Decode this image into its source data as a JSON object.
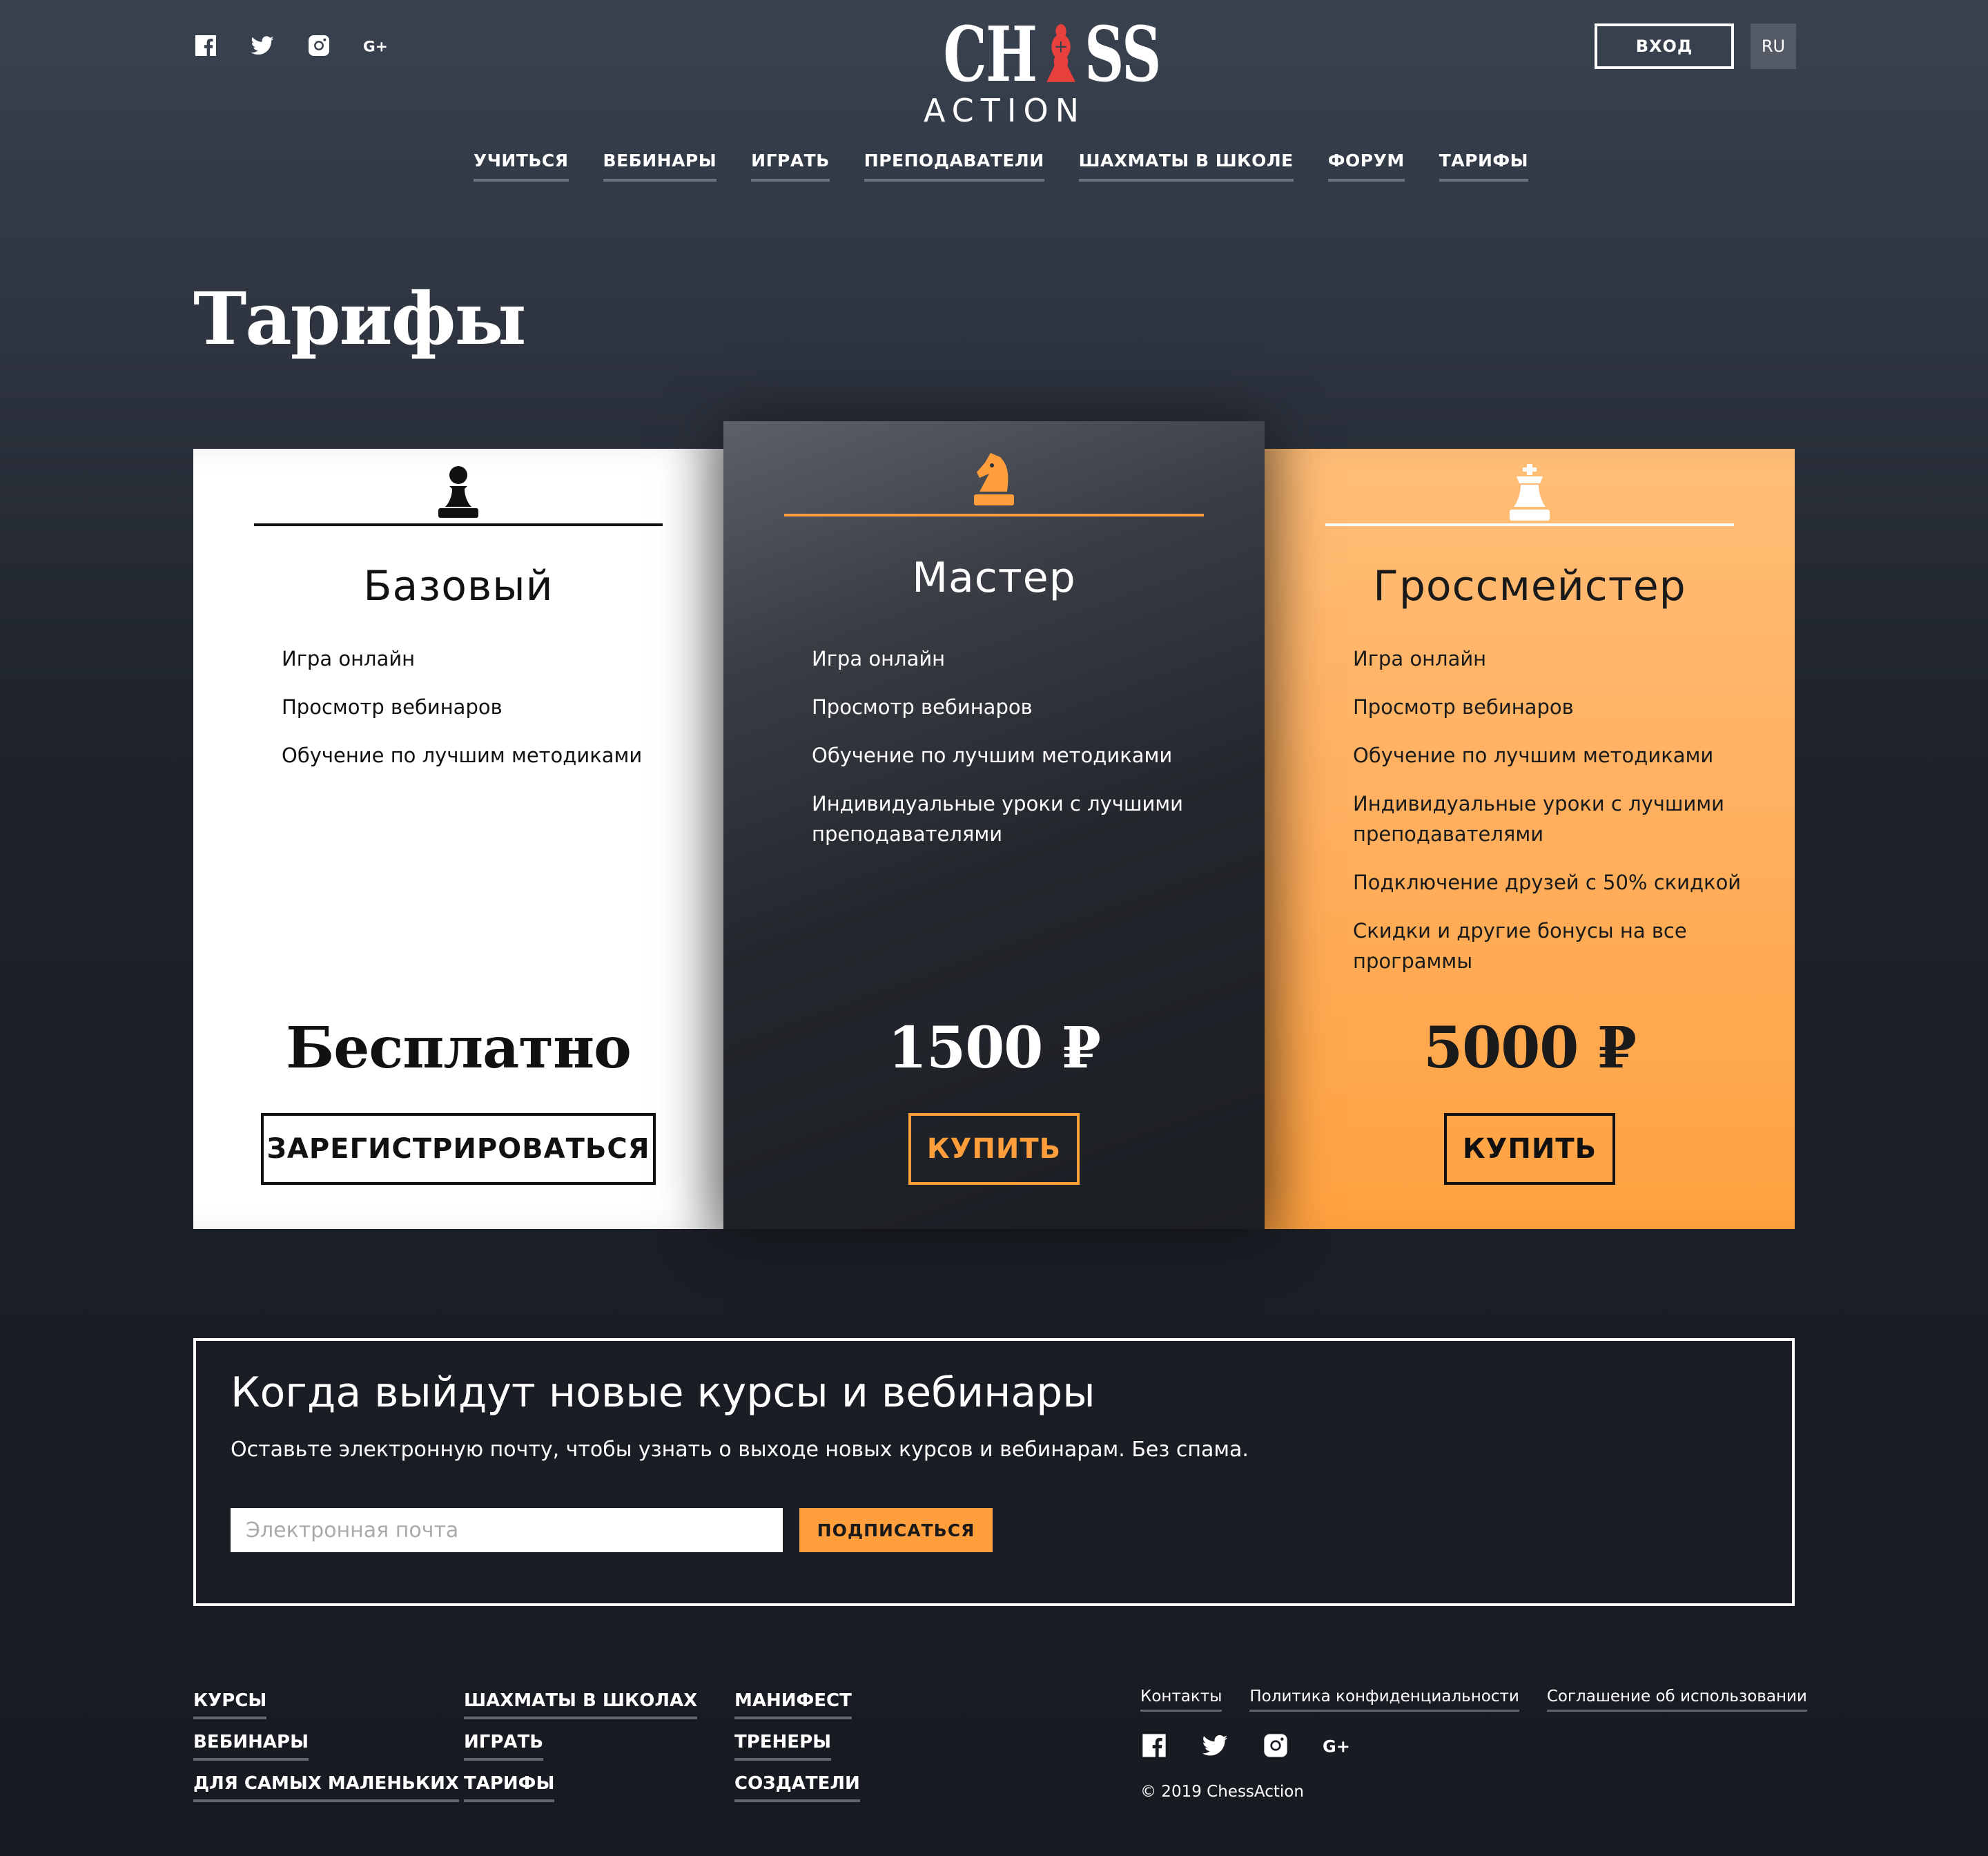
{
  "header": {
    "social_icons": [
      "facebook-icon",
      "twitter-icon",
      "instagram-icon",
      "google-plus-icon"
    ],
    "logo": {
      "top": "CHESS",
      "bottom": "ACTION"
    },
    "login_label": "ВХОД",
    "lang_label": "RU"
  },
  "nav": [
    "УЧИТЬСЯ",
    "ВЕБИНАРЫ",
    "ИГРАТЬ",
    "ПРЕПОДАВАТЕЛИ",
    "ШАХМАТЫ В ШКОЛЕ",
    "ФОРУМ",
    "ТАРИФЫ"
  ],
  "page_title": "Тарифы",
  "plans": [
    {
      "icon": "pawn-icon",
      "name": "Базовый",
      "features": [
        "Игра онлайн",
        "Просмотр вебинаров",
        "Обучение по лучшим методиками"
      ],
      "price": "Бесплатно",
      "button": "ЗАРЕГИСТРИРОВАТЬСЯ"
    },
    {
      "icon": "knight-icon",
      "name": "Мастер",
      "features": [
        "Игра онлайн",
        "Просмотр вебинаров",
        "Обучение по лучшим методиками",
        "Индивидуальные уроки с лучшими преподавателями"
      ],
      "price": "1500 ₽",
      "button": "КУПИТЬ"
    },
    {
      "icon": "king-icon",
      "name": "Гроссмейстер",
      "features": [
        "Игра онлайн",
        "Просмотр вебинаров",
        "Обучение по лучшим методиками",
        "Индивидуальные уроки с лучшими преподавателями",
        "Подключение друзей с 50% скидкой",
        "Скидки и другие бонусы на все программы"
      ],
      "price": "5000 ₽",
      "button": "КУПИТЬ"
    }
  ],
  "subscribe": {
    "title": "Когда выйдут новые курсы и вебинары",
    "description": "Оставьте электронную почту, чтобы узнать о выходе новых курсов и вебинарам. Без спама.",
    "placeholder": "Электронная почта",
    "button": "ПОДПИСАТЬСЯ"
  },
  "footer": {
    "col1": [
      "КУРСЫ",
      "ВЕБИНАРЫ",
      "ДЛЯ САМЫХ МАЛЕНЬКИХ"
    ],
    "col2": [
      "ШАХМАТЫ В ШКОЛАХ",
      "ИГРАТЬ",
      "ТАРИФЫ"
    ],
    "col3": [
      "МАНИФЕСТ",
      "ТРЕНЕРЫ",
      "СОЗДАТЕЛИ"
    ],
    "legal": [
      "Контакты",
      "Политика конфиденциальности",
      "Соглашение об использовании"
    ],
    "copyright": "© 2019 ChessAction"
  },
  "colors": {
    "accent": "#ff9e3b",
    "logo_red": "#e8413d",
    "gm_card": "#ffb060"
  }
}
